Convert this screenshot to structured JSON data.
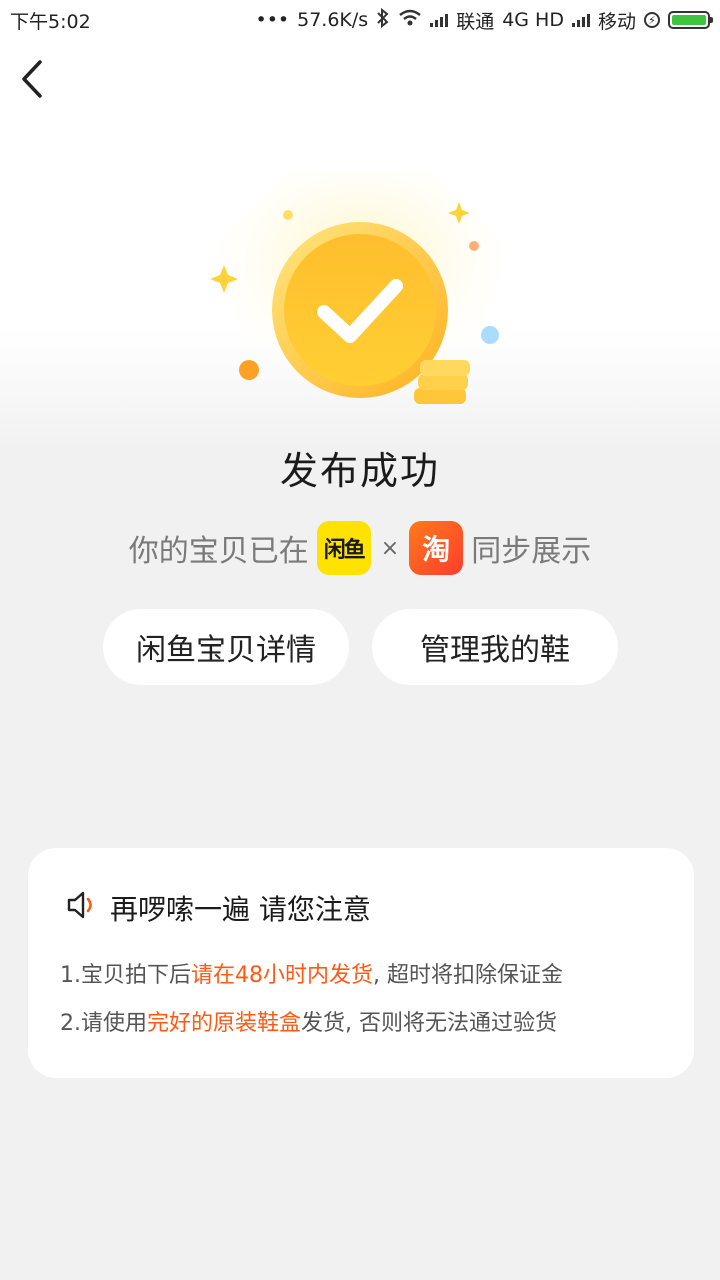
{
  "status_bar": {
    "time": "下午5:02",
    "dots": "•••",
    "speed": "57.6K/s",
    "carrier1": "联通",
    "network": "4G HD",
    "carrier2": "移动"
  },
  "hero": {
    "title": "发布成功"
  },
  "sync": {
    "prefix": "你的宝贝已在",
    "xianyu_logo_text": "闲鱼",
    "times": "×",
    "taobao_logo_text": "淘",
    "suffix": "同步展示"
  },
  "buttons": {
    "detail": "闲鱼宝贝详情",
    "manage": "管理我的鞋"
  },
  "notice": {
    "heading": "再啰嗦一遍 请您注意",
    "line1": {
      "a": "1.宝贝拍下后",
      "hl": "请在48小时内发货",
      "b": ", 超时将扣除保证金"
    },
    "line2": {
      "a": "2.请使用",
      "hl": "完好的原装鞋盒",
      "b": "发货, 否则将无法通过验货"
    }
  },
  "colors": {
    "accent": "#ff5a14",
    "coin": "#ffb020",
    "xianyu": "#ffe200",
    "taobao": "#ff5a1f"
  }
}
